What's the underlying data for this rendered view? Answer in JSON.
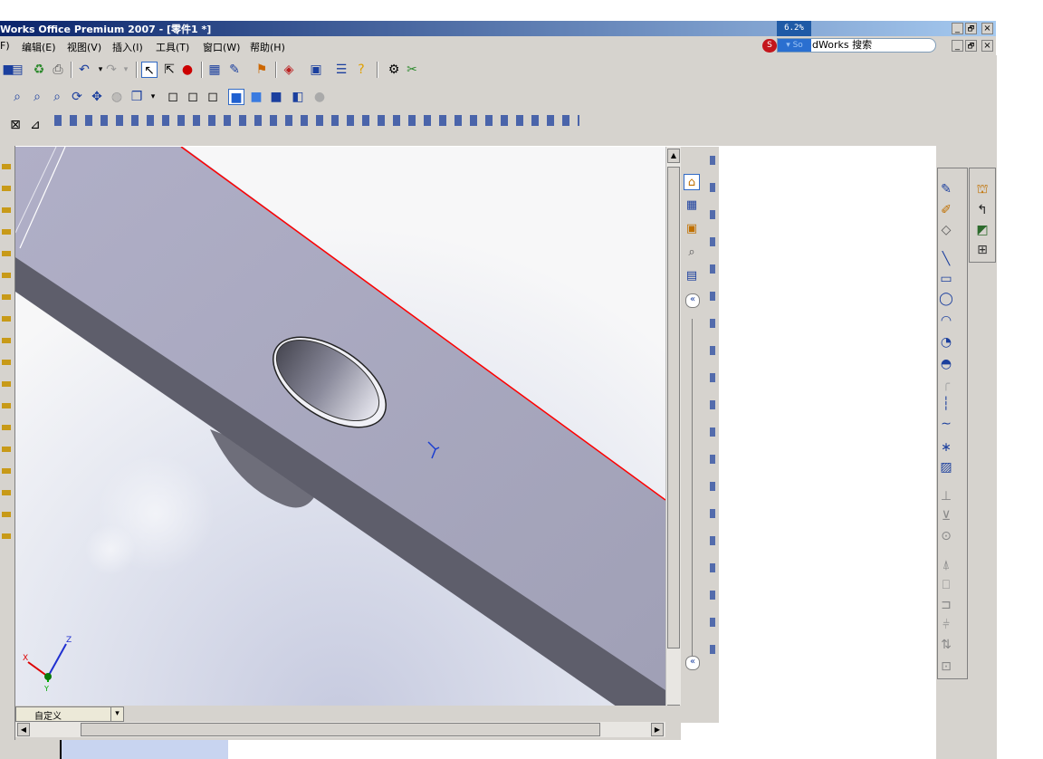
{
  "app": {
    "title": "Works Office Premium 2007 - [零件1 *]",
    "progress_text": "6.2%"
  },
  "menubar": {
    "items": [
      "F)",
      "编辑(E)",
      "视图(V)",
      "插入(I)",
      "工具(T)",
      "窗口(W)",
      "帮助(H)"
    ]
  },
  "search": {
    "value": "dWorks 搜索",
    "prefix": "▾ So"
  },
  "window_controls": {
    "minimize": "_",
    "restore": "🗗",
    "close": "×"
  },
  "view_selector": {
    "value": "自定义",
    "arrow": "▾"
  },
  "taskpane": {
    "collapse_glyph": "«"
  },
  "colors": {
    "titlebar_start": "#0a246a",
    "titlebar_end": "#a6caf0",
    "chrome": "#d6d3ce",
    "part_top": "#a3a2bd",
    "part_side": "#5c5c68",
    "edge_highlight": "#ff0000",
    "progress_bg": "#1f5aa6"
  },
  "icons": {
    "toolbar1": [
      "save-icon",
      "print-preview-icon",
      "options-icon",
      "print-icon",
      "undo-icon",
      "redo-icon",
      "select-icon",
      "select-filter-icon",
      "rebuild-icon",
      "grid-icon",
      "spelling-icon",
      "macro-icon",
      "cube-icon",
      "window-icon",
      "properties-icon",
      "help-icon",
      "edit-icon",
      "scissors-icon"
    ],
    "toolbar2": [
      "zoom-area-icon",
      "zoom-in-out-icon",
      "zoom-fit-icon",
      "rotate-icon",
      "pan-icon",
      "views-icon",
      "view-orientation-icon",
      "wireframe-icon",
      "hidden-lines-icon",
      "shaded-icon",
      "shaded-edges-icon",
      "shadows-icon",
      "section-view-icon",
      "realview-icon"
    ]
  }
}
